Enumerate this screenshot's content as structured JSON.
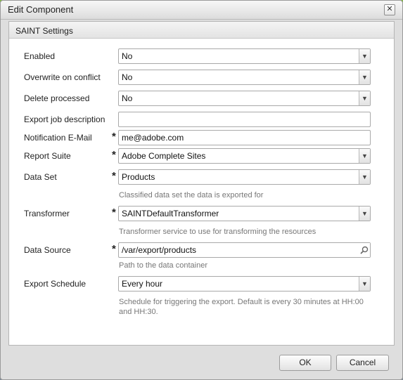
{
  "dialog": {
    "title": "Edit Component",
    "close_glyph": "✕"
  },
  "panel": {
    "header": "SAINT Settings"
  },
  "fields": {
    "enabled": {
      "label": "Enabled",
      "value": "No"
    },
    "overwrite": {
      "label": "Overwrite on conflict",
      "value": "No"
    },
    "delete_processed": {
      "label": "Delete processed",
      "value": "No"
    },
    "export_desc": {
      "label": "Export job description",
      "value": ""
    },
    "notification": {
      "label": "Notification E-Mail",
      "required": "*",
      "value": "me@adobe.com"
    },
    "report_suite": {
      "label": "Report Suite",
      "required": "*",
      "value": "Adobe Complete Sites"
    },
    "data_set": {
      "label": "Data Set",
      "required": "*",
      "value": "Products",
      "hint": "Classified data set the data is exported for"
    },
    "transformer": {
      "label": "Transformer",
      "required": "*",
      "value": "SAINTDefaultTransformer",
      "hint": "Transformer service to use for transforming the resources"
    },
    "data_source": {
      "label": "Data Source",
      "required": "*",
      "value": "/var/export/products",
      "hint": "Path to the data container"
    },
    "schedule": {
      "label": "Export Schedule",
      "value": "Every hour",
      "hint": "Schedule for triggering the export. Default is every 30 minutes at HH:00 and HH:30."
    }
  },
  "icons": {
    "dropdown": "chevron-down-icon",
    "search": "search-icon"
  },
  "footer": {
    "ok": "OK",
    "cancel": "Cancel"
  }
}
